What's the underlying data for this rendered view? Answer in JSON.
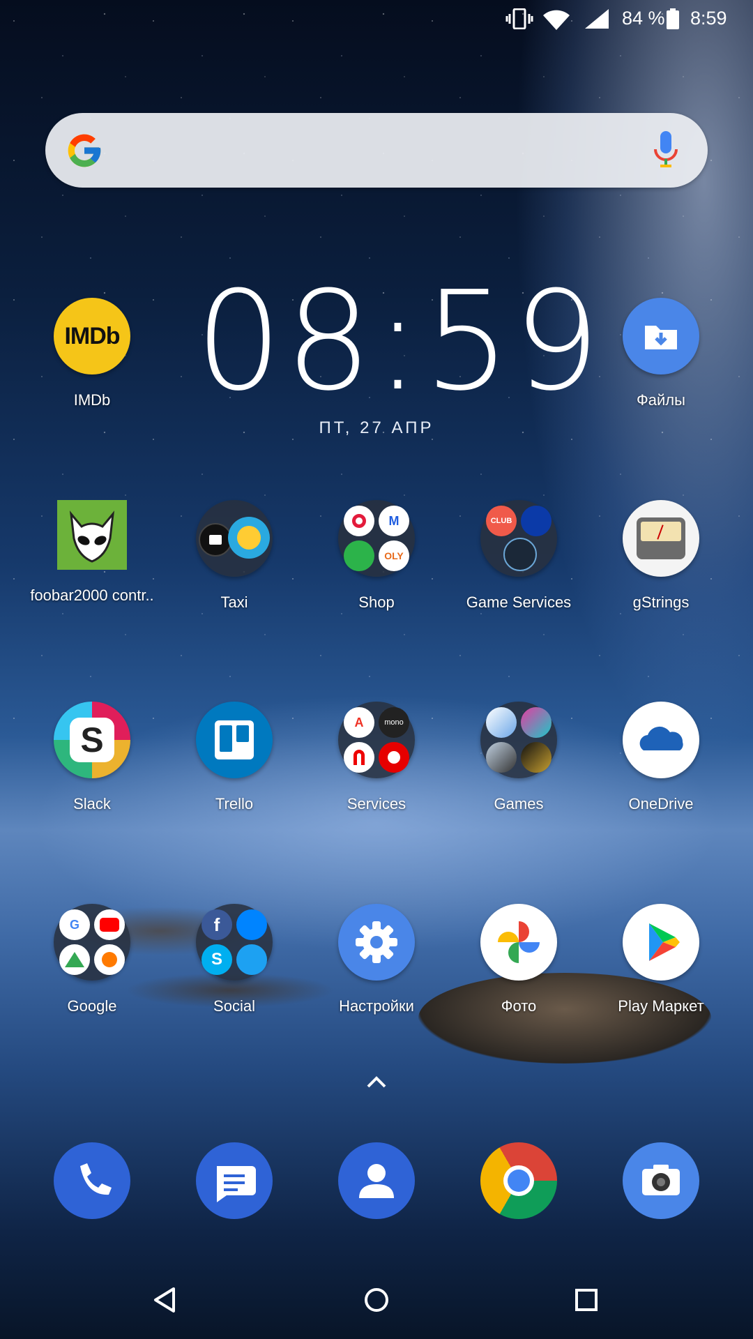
{
  "status_bar": {
    "battery": "84 %",
    "time": "8:59"
  },
  "widget": {
    "clock": "08:59",
    "date": "ПТ, 27 АПР"
  },
  "apps": {
    "imdb": "IMDb",
    "files": "Файлы",
    "foobar": "foobar2000 contr..",
    "taxi": "Taxi",
    "shop": "Shop",
    "game_services": "Game Services",
    "gstrings": "gStrings",
    "slack": "Slack",
    "trello": "Trello",
    "services": "Services",
    "games": "Games",
    "onedrive": "OneDrive",
    "google": "Google",
    "social": "Social",
    "settings": "Настройки",
    "photos": "Фото",
    "play_market": "Play Маркет"
  },
  "icon_texts": {
    "imdb_logo": "IMDb",
    "shop_ozon": "M",
    "services_alfa": "A",
    "services_mono": "mono",
    "game_services_club": "CLUB",
    "shop_oly": "OLY"
  },
  "colors": {
    "imdb": "#f5c518",
    "blue_icon": "#4a86e8",
    "trello": "#0079bf",
    "phone": "#2f63d6"
  },
  "icons": [
    "vibrate-icon",
    "wifi-icon",
    "signal-icon",
    "battery-icon",
    "google-logo-icon",
    "mic-icon",
    "app-drawer-arrow-icon",
    "back-icon",
    "home-icon",
    "recents-icon"
  ]
}
